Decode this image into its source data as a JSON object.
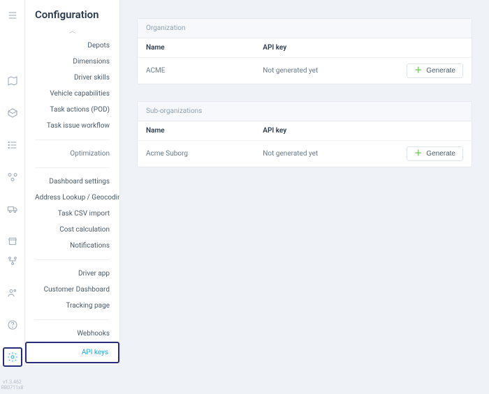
{
  "app": {
    "version_line1": "v1.3.462",
    "version_line2": "RB0711x8"
  },
  "page_title": "Configuration",
  "sidebar": {
    "group0": {
      "items": [
        {
          "label": "Depots"
        },
        {
          "label": "Dimensions"
        },
        {
          "label": "Driver skills"
        },
        {
          "label": "Vehicle capabilities"
        },
        {
          "label": "Task actions (POD)"
        },
        {
          "label": "Task issue workflow"
        }
      ]
    },
    "group1_head": "Optimization",
    "group2": {
      "items": [
        {
          "label": "Dashboard settings"
        },
        {
          "label": "Address Lookup / Geocoding"
        },
        {
          "label": "Task CSV import"
        },
        {
          "label": "Cost calculation"
        },
        {
          "label": "Notifications"
        }
      ]
    },
    "group3": {
      "items": [
        {
          "label": "Driver app"
        },
        {
          "label": "Customer Dashboard"
        },
        {
          "label": "Tracking page"
        }
      ]
    },
    "group4": {
      "items": [
        {
          "label": "Webhooks"
        },
        {
          "label": "API keys"
        }
      ]
    }
  },
  "sections": {
    "organization": {
      "title": "Organization",
      "columns": {
        "name": "Name",
        "key": "API key"
      },
      "rows": [
        {
          "name": "ACME",
          "key": "Not generated yet",
          "action": "Generate"
        }
      ]
    },
    "suborganizations": {
      "title": "Sub-organizations",
      "columns": {
        "name": "Name",
        "key": "API key"
      },
      "rows": [
        {
          "name": "Acme Suborg",
          "key": "Not generated yet",
          "action": "Generate"
        }
      ]
    }
  }
}
